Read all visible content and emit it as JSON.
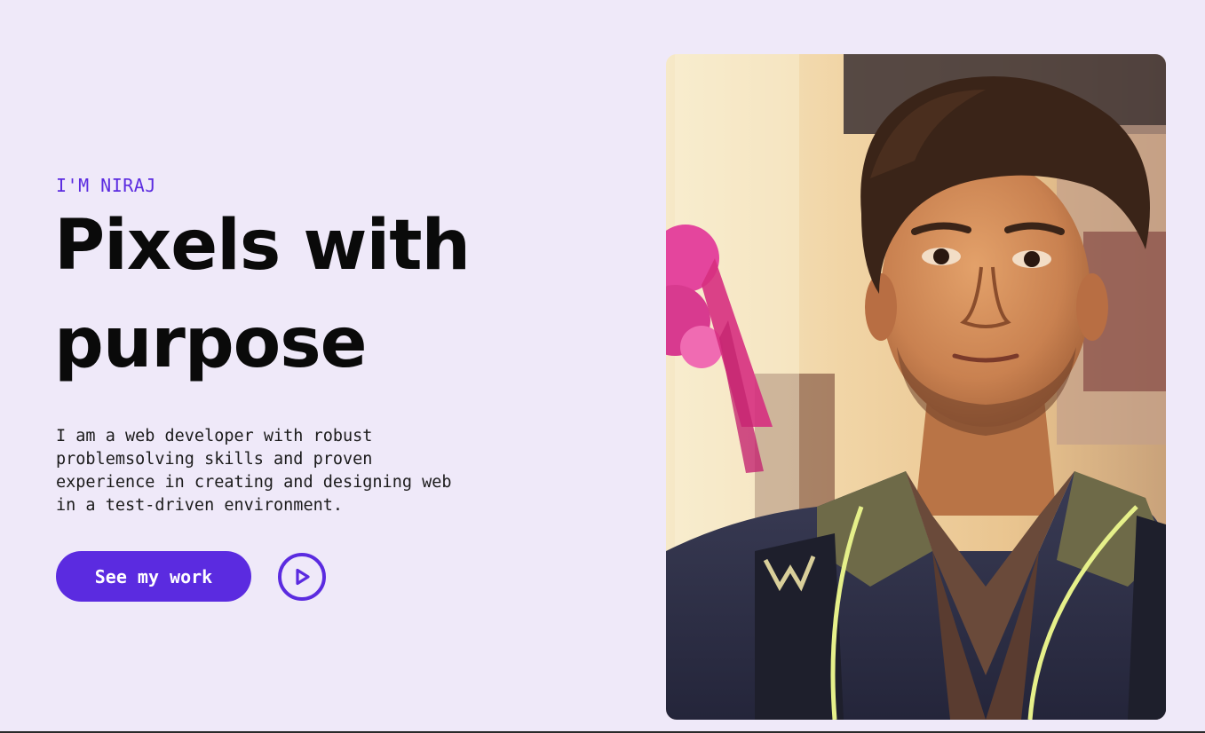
{
  "hero": {
    "eyebrow": "I'M NIRAJ",
    "headline": [
      "Pixels with",
      "purpose"
    ],
    "bio": [
      "I am a web developer with robust",
      "problemsolving skills and proven",
      "experience in creating and designing web",
      "in a test-driven environment."
    ],
    "cta_label": "See my work",
    "play_icon": "play-circle-icon",
    "portrait_alt": "Portrait photo of Niraj"
  },
  "colors": {
    "background": "#efe9f9",
    "accent": "#5b2be0",
    "text": "#0a0a0a"
  }
}
